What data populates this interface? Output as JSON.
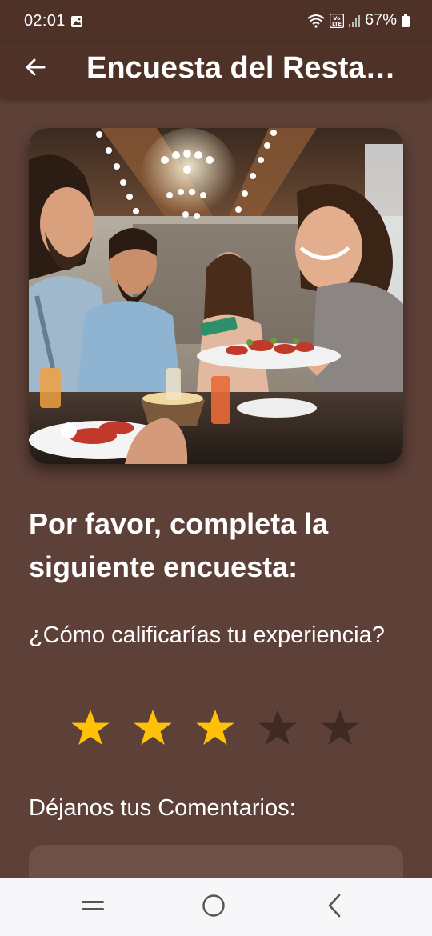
{
  "status_bar": {
    "time": "02:01",
    "network_badge": "VoLTE",
    "battery": "67%"
  },
  "app_bar": {
    "title": "Encuesta del Restaurante"
  },
  "hero": {
    "icon": "restaurant-photo"
  },
  "survey": {
    "heading": "Por favor, completa la siguiente encuesta:",
    "question": "¿Cómo calificarías tu experiencia?",
    "rating": 3,
    "max_rating": 5,
    "comments_label": "Déjanos tus Comentarios:",
    "comments_value": ""
  },
  "colors": {
    "background": "#5d4037",
    "app_bar": "#4e3228",
    "star_filled": "#ffc107",
    "star_empty": "#3e2a22",
    "input_bg": "#6d5047"
  }
}
